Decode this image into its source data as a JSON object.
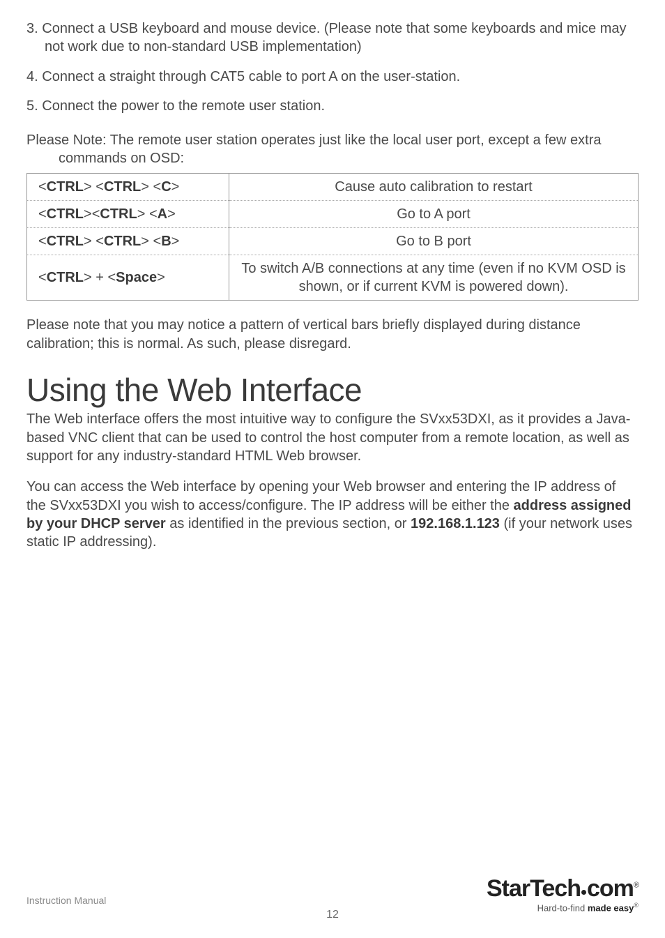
{
  "list": {
    "item3_num": "3.",
    "item3": "Connect a USB keyboard and mouse device. (Please note that some keyboards and mice may not work due to non-standard USB implementation)",
    "item4_num": "4.",
    "item4": "Connect a straight through CAT5 cable to port A on the user-station.",
    "item5_num": "5.",
    "item5": "Connect the power to the remote user station."
  },
  "note": "Please Note: The remote user station operates just like the local user port, except a few extra commands on OSD:",
  "table": {
    "rows": [
      {
        "k1": "<",
        "kb1": "CTRL",
        "k2": "> <",
        "kb2": "CTRL",
        "k3": "> <",
        "kb3": "C",
        "k4": ">",
        "desc": "Cause auto calibration to restart"
      },
      {
        "k1": "<",
        "kb1": "CTRL",
        "k2": "><",
        "kb2": "CTRL",
        "k3": "> <",
        "kb3": "A",
        "k4": ">",
        "desc": "Go to A port"
      },
      {
        "k1": "<",
        "kb1": "CTRL",
        "k2": "> <",
        "kb2": "CTRL",
        "k3": "> <",
        "kb3": "B",
        "k4": ">",
        "desc": "Go to B port"
      },
      {
        "k1": "<",
        "kb1": "CTRL",
        "k2": "> + <",
        "kb2": "Space",
        "k3": ">",
        "kb3": "",
        "k4": "",
        "desc": "To switch A/B connections at any time (even if no KVM OSD is shown, or if current KVM is powered down)."
      }
    ]
  },
  "para_after_table": "Please note that you may notice a pattern of vertical bars briefly displayed during distance calibration; this is normal.  As such, please disregard.",
  "heading": "Using the Web Interface",
  "web_p1": "The Web interface offers the most intuitive way to configure the SVxx53DXI, as it provides a Java-based VNC client that can be used to control the host computer from a remote location, as well as support for any industry-standard HTML Web browser.",
  "web_p2_a": "You can access the Web interface by opening your Web browser and entering the IP address of the SVxx53DXI you wish to access/configure. The IP address will be either the ",
  "web_p2_b": "address assigned by your DHCP server",
  "web_p2_c": " as identified in the previous section, or ",
  "web_p2_d": "192.168.1.123",
  "web_p2_e": " (if your network uses static IP addressing).",
  "footer": {
    "left": "Instruction Manual",
    "page": "12",
    "logo_a": "StarTech",
    "logo_b": "com",
    "reg": "®",
    "tag_a": "Hard-to-find ",
    "tag_b": "made easy",
    "tag_c": "®"
  }
}
